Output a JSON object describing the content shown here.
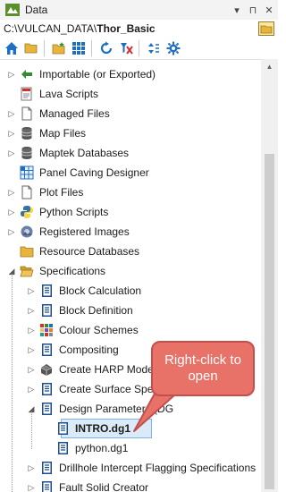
{
  "window": {
    "title": "Data",
    "pin_glyph": "▾",
    "pin2_glyph": "⊓",
    "close_glyph": "✕"
  },
  "path": {
    "prefix": "C:\\VULCAN_DATA\\",
    "project": "Thor_Basic"
  },
  "toolbar": {
    "tools": [
      "home-icon",
      "open-folder-icon",
      "new-folder-icon",
      "grid-icon",
      "refresh-icon",
      "filter-off-icon",
      "sort-icon",
      "settings-icon"
    ]
  },
  "tree": {
    "items": [
      {
        "label": "Importable (or Exported)",
        "icon": "importable-icon",
        "expander": "collapsed"
      },
      {
        "label": "Lava Scripts",
        "icon": "script-icon",
        "expander": "none"
      },
      {
        "label": "Managed Files",
        "icon": "page-icon",
        "expander": "collapsed"
      },
      {
        "label": "Map Files",
        "icon": "database-icon",
        "expander": "collapsed"
      },
      {
        "label": "Maptek Databases",
        "icon": "database-icon",
        "expander": "collapsed"
      },
      {
        "label": "Panel Caving Designer",
        "icon": "grid-table-icon",
        "expander": "none"
      },
      {
        "label": "Plot Files",
        "icon": "page-icon",
        "expander": "collapsed"
      },
      {
        "label": "Python Scripts",
        "icon": "python-icon",
        "expander": "collapsed"
      },
      {
        "label": "Registered Images",
        "icon": "image-icon",
        "expander": "collapsed"
      },
      {
        "label": "Resource Databases",
        "icon": "folder-icon",
        "expander": "none"
      },
      {
        "label": "Specifications",
        "icon": "open-folder-icon",
        "expander": "expanded"
      },
      {
        "label": "Block Calculation",
        "icon": "spec-doc-icon",
        "expander": "collapsed"
      },
      {
        "label": "Block Definition",
        "icon": "spec-doc-icon",
        "expander": "collapsed"
      },
      {
        "label": "Colour Schemes",
        "icon": "colour-scheme-icon",
        "expander": "collapsed"
      },
      {
        "label": "Compositing",
        "icon": "spec-doc-icon",
        "expander": "collapsed"
      },
      {
        "label": "Create HARP Model S",
        "icon": "harp-model-icon",
        "expander": "collapsed"
      },
      {
        "label": "Create Surface Specif",
        "icon": "spec-doc-icon",
        "expander": "collapsed"
      },
      {
        "label": "Design Parameters (DG",
        "icon": "spec-doc-icon",
        "expander": "expanded"
      },
      {
        "label": "INTRO.dg1",
        "icon": "spec-doc-icon",
        "expander": "none",
        "selected": true
      },
      {
        "label": "python.dg1",
        "icon": "spec-doc-icon",
        "expander": "none"
      },
      {
        "label": "Drillhole Intercept Flagging Specifications",
        "icon": "spec-doc-icon",
        "expander": "collapsed"
      },
      {
        "label": "Fault Solid Creator",
        "icon": "spec-doc-icon",
        "expander": "collapsed"
      }
    ]
  },
  "callout": {
    "text": "Right-click to open"
  },
  "colors": {
    "accent": "#1e6fc4",
    "callout_fill": "#e87168",
    "callout_border": "#c0504d",
    "selection": "#dbeaf7"
  }
}
